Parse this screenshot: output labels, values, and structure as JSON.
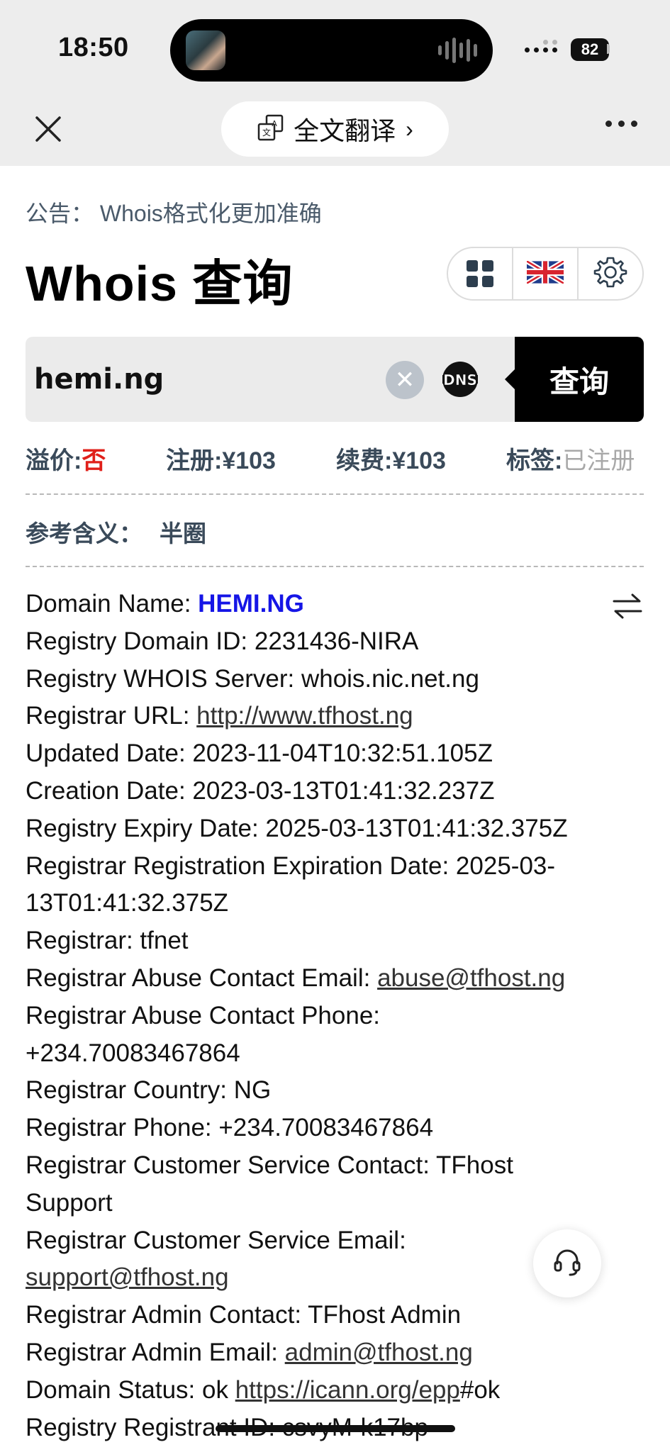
{
  "status_bar": {
    "time": "18:50",
    "battery": "82"
  },
  "browser": {
    "translate_label": "全文翻译",
    "translate_chevron": "›",
    "icons": {
      "close": "close-icon",
      "translate": "translate-icon",
      "more": "more-icon"
    }
  },
  "notice": "公告： Whois格式化更加准确",
  "title": "Whois 查询",
  "toolbar": {
    "icons": [
      "grid-icon",
      "uk-flag-icon",
      "gear-icon"
    ]
  },
  "search": {
    "value": "hemi.ng",
    "clear_symbol": "✕",
    "dns_label": "DNS",
    "query_label": "查询"
  },
  "stats": {
    "premium_label": "溢价:",
    "premium_value": "否",
    "register_label": "注册:",
    "register_value": "¥103",
    "renew_label": "续费:",
    "renew_value": "¥103",
    "tag_label": "标签:",
    "tag_value": "已注册"
  },
  "meaning": {
    "label": "参考含义：",
    "value": "半圈"
  },
  "whois": {
    "domain_name_label": "Domain Name: ",
    "domain_name_value": "HEMI.NG",
    "registry_domain_id": "Registry Domain ID: 2231436-NIRA",
    "whois_server": "Registry WHOIS Server: whois.nic.net.ng",
    "registrar_url_label": "Registrar URL: ",
    "registrar_url_value": "http://www.tfhost.ng",
    "updated_date": "Updated Date: 2023-11-04T10:32:51.105Z",
    "creation_date": "Creation Date: 2023-03-13T01:41:32.237Z",
    "expiry_date": "Registry Expiry Date: 2025-03-13T01:41:32.375Z",
    "registrar_expiration_1": "Registrar Registration Expiration Date: 2025-03-",
    "registrar_expiration_2": "13T01:41:32.375Z",
    "registrar": "Registrar: tfnet",
    "abuse_email_label": "Registrar Abuse Contact Email: ",
    "abuse_email_value": "abuse@tfhost.ng",
    "abuse_phone_1": "Registrar Abuse Contact Phone:",
    "abuse_phone_2": "+234.70083467864",
    "country": "Registrar Country: NG",
    "phone": "Registrar Phone: +234.70083467864",
    "cs_contact_1": "Registrar Customer Service Contact: TFhost",
    "cs_contact_2": "Support",
    "cs_email_label": "Registrar Customer Service Email:",
    "cs_email_value": "support@tfhost.ng",
    "admin_contact": "Registrar Admin Contact: TFhost Admin",
    "admin_email_label": "Registrar Admin Email: ",
    "admin_email_value": "admin@tfhost.ng",
    "status_label": "Domain Status: ok ",
    "status_link": "https://icann.org/epp",
    "status_suffix": "#ok",
    "registrant_id": "Registry Registrant ID: csvyM-k17bp"
  }
}
